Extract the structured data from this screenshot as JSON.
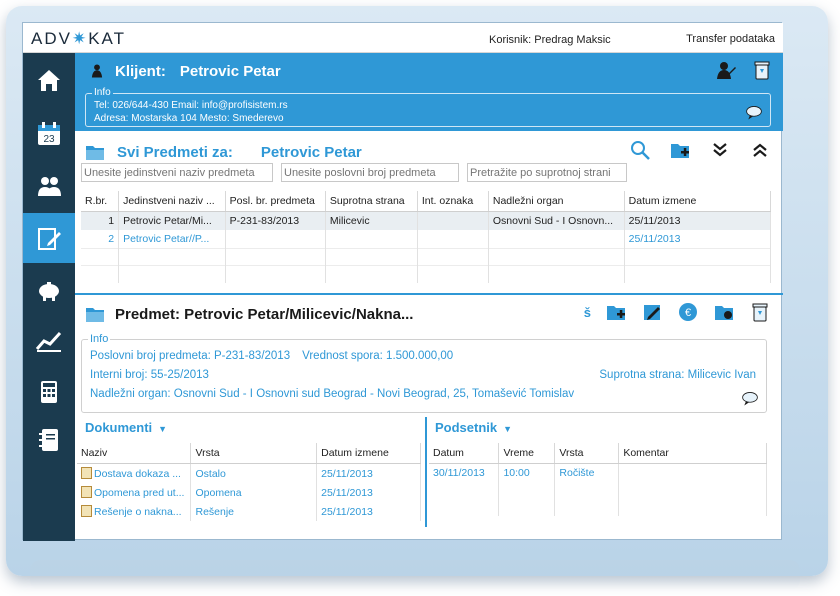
{
  "app": {
    "logo_left": "ADV",
    "logo_right": "KAT",
    "user_label": "Korisnik: Predrag Maksic",
    "transfer_label": "Transfer podataka"
  },
  "sidebar": {
    "items": [
      {
        "name": "home-icon"
      },
      {
        "name": "calendar-icon",
        "label": "23"
      },
      {
        "name": "clients-icon"
      },
      {
        "name": "cases-icon"
      },
      {
        "name": "piggybank-icon"
      },
      {
        "name": "chart-icon"
      },
      {
        "name": "calculator-icon"
      },
      {
        "name": "notebook-icon"
      }
    ]
  },
  "client": {
    "title_label": "Klijent:",
    "name": "Petrovic Petar",
    "info_legend": "Info",
    "line1": "Tel: 026/644-430   Email: info@profisistem.rs",
    "line2": "Adresa: Mostarska 104   Mesto: Smederevo"
  },
  "subjects": {
    "title_label": "Svi Predmeti za:",
    "client_name": "Petrovic Petar",
    "filters": [
      "Unesite jedinstveni naziv predmeta",
      "Unesite poslovni broj predmeta",
      "Pretražite po suprotnoj strani"
    ],
    "columns": [
      "R.br.",
      "Jedinstveni naziv ...",
      "Posl. br. predmeta",
      "Suprotna strana",
      "Int. oznaka",
      "Nadležni organ",
      "Datum izmene"
    ],
    "rows": [
      [
        "1",
        "Petrovic Petar/Mi...",
        "P-231-83/2013",
        "Milicevic",
        "",
        "Osnovni Sud - I Osnovn...",
        "25/11/2013"
      ],
      [
        "2",
        "Petrovic Petar//P...",
        "",
        "",
        "",
        "",
        "25/11/2013"
      ]
    ]
  },
  "case": {
    "title": "Predmet: Petrovic Petar/Milicevic/Nakna...",
    "tool_s": "š",
    "info_legend": "Info",
    "business_no": "Poslovni broj predmeta: P-231-83/2013",
    "dispute_value": "Vrednost spora: 1.500.000,00",
    "internal_no": "Interni broj: 55-25/2013",
    "opposing": "Suprotna strana: Milicevic Ivan",
    "authority": "Nadležni organ: Osnovni Sud - I Osnovni sud Beograd - Novi Beograd,  25,  Tomašević Tomislav"
  },
  "documents": {
    "title": "Dokumenti",
    "arrow": "▼",
    "columns": [
      "Naziv",
      "Vrsta",
      "Datum izmene"
    ],
    "rows": [
      [
        "Dostava dokaza ...",
        "Ostalo",
        "25/11/2013"
      ],
      [
        "Opomena pred ut...",
        "Opomena",
        "25/11/2013"
      ],
      [
        "Rešenje o nakna...",
        "Rešenje",
        "25/11/2013"
      ]
    ]
  },
  "reminders": {
    "title": "Podsetnik",
    "arrow": "▼",
    "columns": [
      "Datum",
      "Vreme",
      "Vrsta",
      "Komentar"
    ],
    "rows": [
      [
        "30/11/2013",
        "10:00",
        "Ročište",
        ""
      ]
    ]
  },
  "colors": {
    "accent": "#2f98d6",
    "sidebar": "#1b3b4f"
  }
}
